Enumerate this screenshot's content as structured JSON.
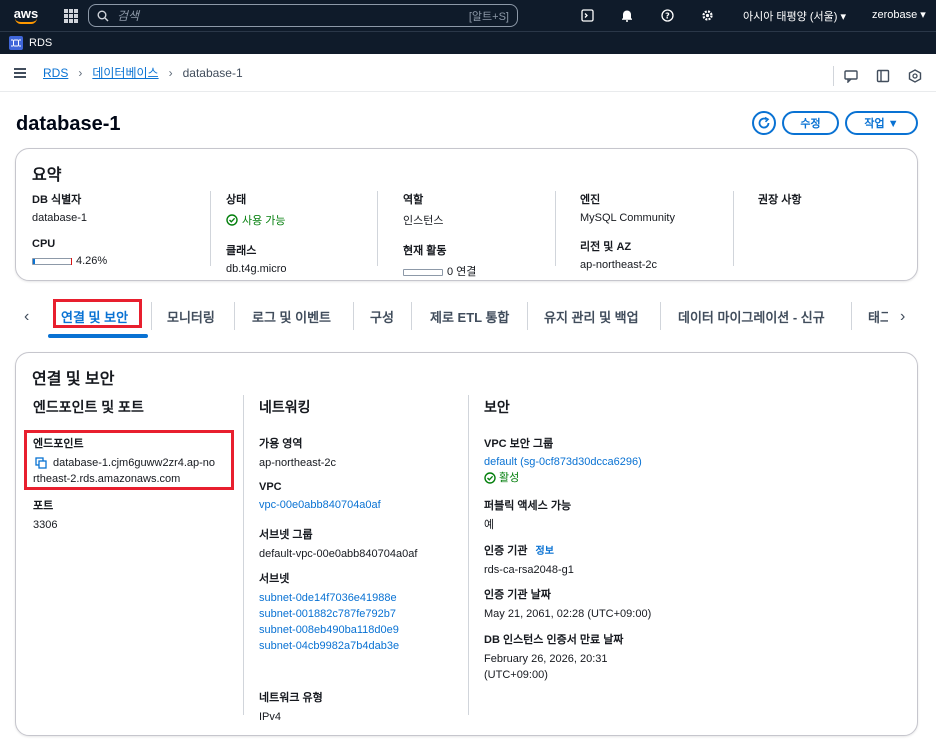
{
  "topnav": {
    "logo": "aws",
    "search_placeholder": "검색",
    "search_shortcut": "[알트+S]",
    "region": "아시아 태평양 (서울) ▾",
    "account": "zerobase ▾"
  },
  "service": {
    "label": "RDS",
    "icon_text": "RDS"
  },
  "breadcrumb": {
    "items": [
      "RDS",
      "데이터베이스"
    ],
    "current": "database-1"
  },
  "header": {
    "title": "database-1",
    "edit_label": "수정",
    "actions_label": "작업 ▼"
  },
  "summary": {
    "title": "요약",
    "db_id_label": "DB 식별자",
    "db_id": "database-1",
    "cpu_label": "CPU",
    "cpu_value": "4.26%",
    "cpu_fraction": 0.0426,
    "status_label": "상태",
    "status": "사용 가능",
    "class_label": "클래스",
    "class": "db.t4g.micro",
    "role_label": "역할",
    "role": "인스턴스",
    "activity_label": "현재 활동",
    "activity": "0 연결",
    "activity_fraction": 0,
    "engine_label": "엔진",
    "engine": "MySQL Community",
    "region_az_label": "리전 및 AZ",
    "region_az": "ap-northeast-2c",
    "recommend_label": "권장 사항"
  },
  "tabs": [
    "연결 및 보안",
    "모니터링",
    "로그 및 이벤트",
    "구성",
    "제로 ETL 통합",
    "유지 관리 및 백업",
    "데이터 마이그레이션 - 신규",
    "태그"
  ],
  "connectivity": {
    "title": "연결 및 보안",
    "endpoint_section": "엔드포인트 및 포트",
    "endpoint_label": "엔드포인트",
    "endpoint_line1": "database-1.cjm6guww2zr4.ap-no",
    "endpoint_line2": "rtheast-2.rds.amazonaws.com",
    "port_label": "포트",
    "port": "3306",
    "network_section": "네트워킹",
    "az_label": "가용 영역",
    "az": "ap-northeast-2c",
    "vpc_label": "VPC",
    "vpc": "vpc-00e0abb840704a0af",
    "subnet_group_label": "서브넷 그룹",
    "subnet_group": "default-vpc-00e0abb840704a0af",
    "subnets_label": "서브넷",
    "subnets": [
      "subnet-0de14f7036e41988e",
      "subnet-001882c787fe792b7",
      "subnet-008eb490ba118d0e9",
      "subnet-04cb9982a7b4dab3e"
    ],
    "network_type_label": "네트워크 유형",
    "network_type": "IPv4",
    "security_section": "보안",
    "sg_label": "VPC 보안 그룹",
    "sg": "default (sg-0cf873d30dcca6296)",
    "sg_status": "활성",
    "public_label": "퍼블릭 액세스 가능",
    "public": "예",
    "ca_label": "인증 기관",
    "ca_info": "정보",
    "ca": "rds-ca-rsa2048-g1",
    "ca_date_label": "인증 기관 날짜",
    "ca_date": "May 21, 2061, 02:28 (UTC+09:00)",
    "cert_exp_label": "DB 인스턴스 인증서 만료 날짜",
    "cert_exp_line1": "February 26, 2026, 20:31",
    "cert_exp_line2": "(UTC+09:00)"
  },
  "colors": {
    "accent": "#0972d3",
    "ok": "#037f0c",
    "highlight": "#e81f2e",
    "nav_bg": "#0f1b2a"
  }
}
